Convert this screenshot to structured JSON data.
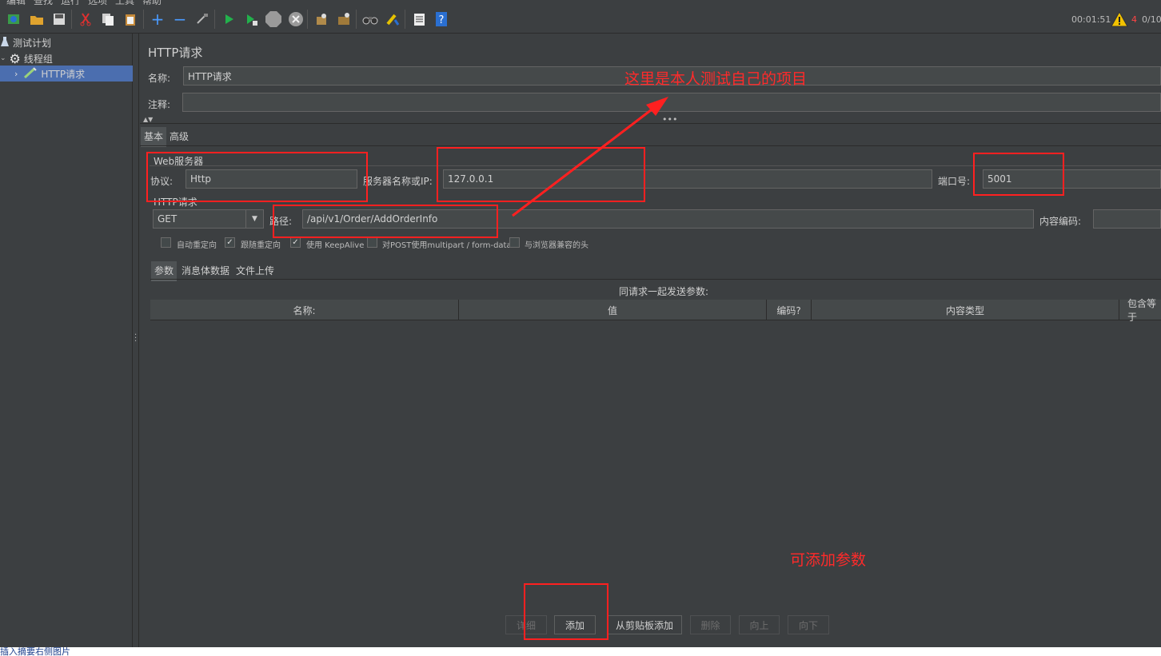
{
  "menu": {
    "items": [
      "编辑",
      "查找",
      "运行",
      "选项",
      "工具",
      "帮助"
    ]
  },
  "toolbar": {
    "icons": [
      "templates-icon",
      "open-icon",
      "save-icon",
      "cut-icon",
      "copy-icon",
      "paste-icon",
      "expand-icon",
      "collapse-icon",
      "toggle-icon",
      "start-icon",
      "start-no-pause-icon",
      "stop-icon",
      "shutdown-icon",
      "clear-icon",
      "clear-all-icon",
      "search-icon",
      "reset-search-icon",
      "function-helper-icon",
      "help-icon"
    ],
    "timer": "00:01:51",
    "warning_count": "4",
    "threads": "0/10"
  },
  "tree": {
    "items": [
      {
        "label": "测试计划",
        "expanded": true
      },
      {
        "label": "线程组",
        "expanded": true
      },
      {
        "label": "HTTP请求",
        "selected": true
      }
    ]
  },
  "panel": {
    "title": "HTTP请求",
    "name_label": "名称:",
    "name_value": "HTTP请求",
    "comment_label": "注释:",
    "comment_value": "",
    "tabs": [
      "基本",
      "高级"
    ],
    "web_server": {
      "group_title": "Web服务器",
      "protocol_label": "协议:",
      "protocol_value": "Http",
      "server_label": "服务器名称或IP:",
      "server_value": "127.0.0.1",
      "port_label": "端口号:",
      "port_value": "5001"
    },
    "http_request": {
      "group_title": "HTTP请求",
      "method": "GET",
      "path_label": "路径:",
      "path_value": "/api/v1/Order/AddOrderInfo",
      "encoding_label": "内容编码:",
      "encoding_value": ""
    },
    "options": [
      {
        "label": "自动重定向",
        "checked": false
      },
      {
        "label": "跟随重定向",
        "checked": true
      },
      {
        "label": "使用 KeepAlive",
        "checked": true
      },
      {
        "label": "对POST使用multipart / form-data",
        "checked": false
      },
      {
        "label": "与浏览器兼容的头",
        "checked": false
      }
    ],
    "sub_tabs": [
      "参数",
      "消息体数据",
      "文件上传"
    ],
    "params_caption": "同请求一起发送参数:",
    "columns": [
      "名称:",
      "值",
      "编码?",
      "内容类型",
      "包含等于"
    ],
    "buttons": [
      {
        "label": "详细",
        "enabled": false
      },
      {
        "label": "添加",
        "enabled": true
      },
      {
        "label": "从剪贴板添加",
        "enabled": true
      },
      {
        "label": "删除",
        "enabled": false
      },
      {
        "label": "向上",
        "enabled": false
      },
      {
        "label": "向下",
        "enabled": false
      }
    ]
  },
  "annotations": {
    "note_top": "这里是本人测试自己的项目",
    "note_bottom": "可添加参数",
    "color": "#ff2020"
  },
  "status": {
    "text": "插入摘要右侧图片"
  }
}
